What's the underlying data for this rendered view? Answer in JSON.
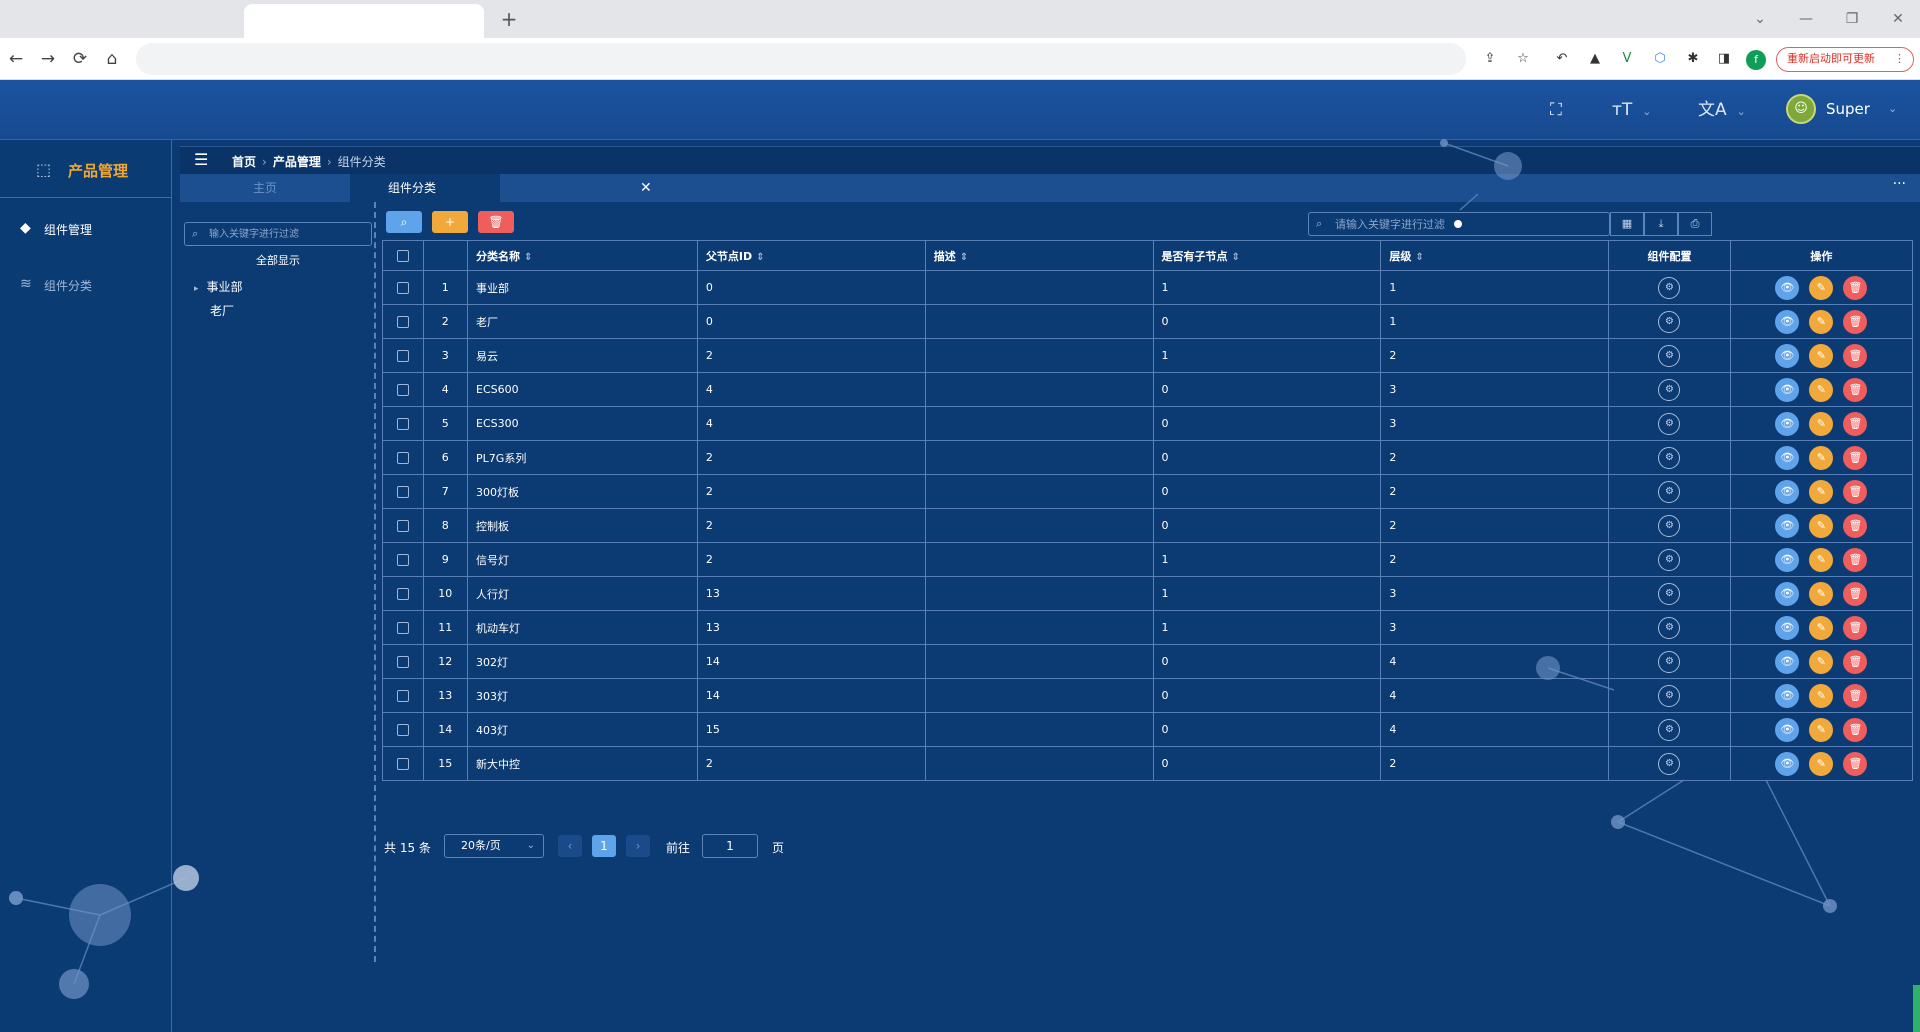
{
  "browser": {
    "new_tab_glyph": "+",
    "window_controls": [
      "⌄",
      "—",
      "❐",
      "✕"
    ],
    "nav": [
      "←",
      "→",
      "⟳",
      "⌂"
    ],
    "extensions": [
      "⇪",
      "☆",
      "↶",
      "▲",
      "V",
      "⬡",
      "✱",
      "◨"
    ],
    "profile_initial": "f",
    "update_label": "重新启动即可更新",
    "update_menu": "⋮"
  },
  "header": {
    "fullscreen_glyph": "⛶",
    "fontsize_glyph": "тT",
    "translate_glyph": "文A",
    "caret": "⌄",
    "user_avatar_glyph": "☺",
    "user_name": "Super"
  },
  "sidebar": {
    "brand": {
      "icon": "cubes-icon",
      "glyph": "⬚",
      "label": "产品管理"
    },
    "items": [
      {
        "name": "sidebar-item-component-management",
        "icon": "cube-icon",
        "glyph": "◆",
        "label": "组件管理"
      },
      {
        "name": "sidebar-item-component-category",
        "icon": "layers-icon",
        "glyph": "≋",
        "label": "组件分类"
      }
    ]
  },
  "breadcrumb": {
    "menu_glyph": "☰",
    "items": [
      "首页",
      "产品管理",
      "组件分类"
    ],
    "sep": "›"
  },
  "tabs": {
    "home": "主页",
    "active": "组件分类",
    "close": "✕",
    "more": "···"
  },
  "tree": {
    "search_glyph": "⌕",
    "search_placeholder": "输入关键字进行过滤",
    "show_all": "全部显示",
    "nodes": [
      {
        "arrow": "▸",
        "label": "事业部"
      },
      {
        "label": "老厂"
      }
    ]
  },
  "toolbar": {
    "search_glyph": "⌕",
    "add_glyph": "+",
    "delete_glyph": "🗑",
    "filter_placeholder": "请输入关键字进行过滤",
    "filter_glyph": "⌕",
    "right_icons": [
      "▦",
      "⤓",
      "⎙"
    ]
  },
  "table": {
    "sort_glyph": "⇕",
    "columns": [
      "分类名称",
      "父节点ID",
      "描述",
      "是否有子节点",
      "层级",
      "组件配置",
      "操作"
    ],
    "config_glyph": "⚙",
    "action_glyphs": {
      "view": "👁",
      "edit": "✎",
      "delete": "🗑"
    },
    "rows": [
      {
        "idx": "1",
        "name": "事业部",
        "parent": "0",
        "desc": "",
        "has_child": "1",
        "level": "1"
      },
      {
        "idx": "2",
        "name": "老厂",
        "parent": "0",
        "desc": "",
        "has_child": "0",
        "level": "1"
      },
      {
        "idx": "3",
        "name": "易云",
        "parent": "2",
        "desc": "",
        "has_child": "1",
        "level": "2"
      },
      {
        "idx": "4",
        "name": "ECS600",
        "parent": "4",
        "desc": "",
        "has_child": "0",
        "level": "3"
      },
      {
        "idx": "5",
        "name": "ECS300",
        "parent": "4",
        "desc": "",
        "has_child": "0",
        "level": "3"
      },
      {
        "idx": "6",
        "name": "PL7G系列",
        "parent": "2",
        "desc": "",
        "has_child": "0",
        "level": "2"
      },
      {
        "idx": "7",
        "name": "300灯板",
        "parent": "2",
        "desc": "",
        "has_child": "0",
        "level": "2"
      },
      {
        "idx": "8",
        "name": "控制板",
        "parent": "2",
        "desc": "",
        "has_child": "0",
        "level": "2"
      },
      {
        "idx": "9",
        "name": "信号灯",
        "parent": "2",
        "desc": "",
        "has_child": "1",
        "level": "2"
      },
      {
        "idx": "10",
        "name": "人行灯",
        "parent": "13",
        "desc": "",
        "has_child": "1",
        "level": "3"
      },
      {
        "idx": "11",
        "name": "机动车灯",
        "parent": "13",
        "desc": "",
        "has_child": "1",
        "level": "3"
      },
      {
        "idx": "12",
        "name": "302灯",
        "parent": "14",
        "desc": "",
        "has_child": "0",
        "level": "4"
      },
      {
        "idx": "13",
        "name": "303灯",
        "parent": "14",
        "desc": "",
        "has_child": "0",
        "level": "4"
      },
      {
        "idx": "14",
        "name": "403灯",
        "parent": "15",
        "desc": "",
        "has_child": "0",
        "level": "4"
      },
      {
        "idx": "15",
        "name": "新大中控",
        "parent": "2",
        "desc": "",
        "has_child": "0",
        "level": "2"
      }
    ]
  },
  "pagination": {
    "total": "共 15 条",
    "page_size": "20条/页",
    "caret": "⌄",
    "prev": "‹",
    "current": "1",
    "next": "›",
    "goto": "前往",
    "goto_value": "1",
    "unit": "页"
  },
  "colors": {
    "background": "#0c3a72",
    "header": "#1a4f96",
    "accent_blue": "#5fa3ea",
    "accent_orange": "#f2a93b",
    "accent_red": "#ef5d5d",
    "brand_text": "#f0a830"
  }
}
